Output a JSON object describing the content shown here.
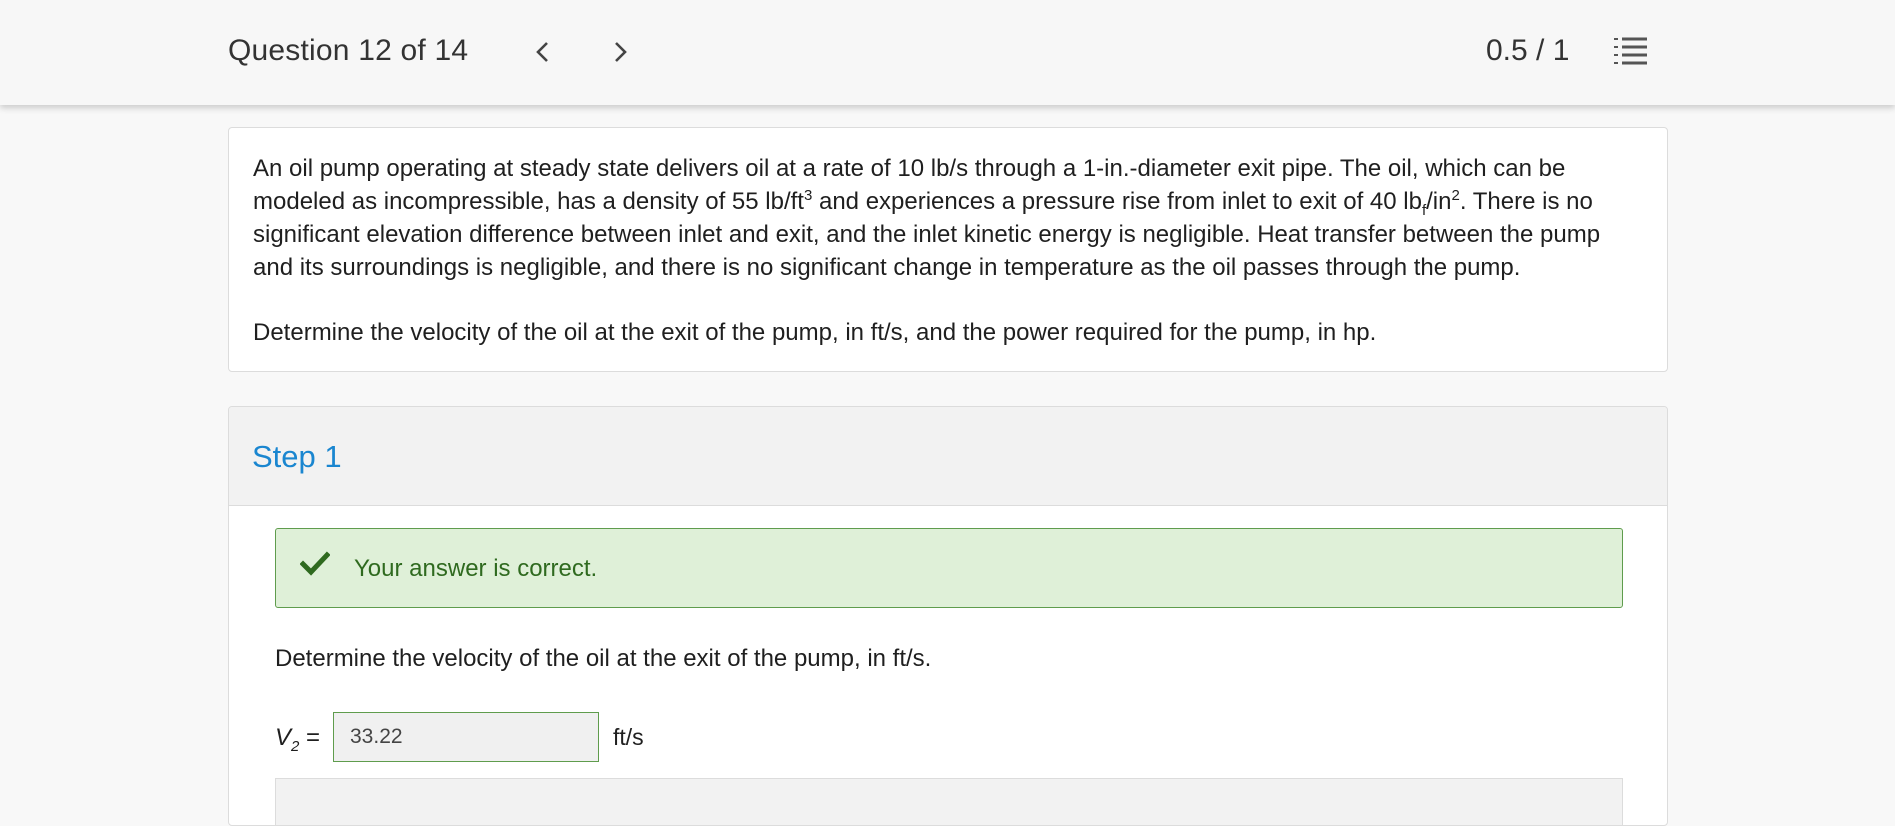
{
  "header": {
    "question_label": "Question 12 of 14",
    "score": "0.5 / 1",
    "icons": {
      "prev": "chevron-left-icon",
      "next": "chevron-right-icon",
      "list": "numbered-list-icon"
    }
  },
  "problem": {
    "p1_a": "An oil pump operating at steady state delivers oil at a rate of 10 lb/s through a 1-in.-diameter exit pipe. The oil, which can be modeled as incompressible, has a density of 55 lb/ft",
    "p1_sup1": "3",
    "p1_b": " and experiences a pressure rise from inlet to exit of 40 lb",
    "p1_sub1": "f",
    "p1_c": "/in",
    "p1_sup2": "2",
    "p1_d": ". There is no significant elevation difference between inlet and exit, and the inlet kinetic energy is negligible. Heat transfer between the pump and its surroundings is negligible, and there is no significant change in temperature as the oil passes through the pump.",
    "question": "Determine the velocity of the oil at the exit of the pump, in ft/s, and the power required for the pump, in hp."
  },
  "step": {
    "title": "Step 1",
    "feedback": "Your answer is correct.",
    "feedback_icon": "checkmark-icon",
    "question": "Determine the velocity of the oil at the exit of the pump, in ft/s.",
    "var_name": "V",
    "var_sub": "2",
    "var_eq": " =",
    "answer_value": "33.22",
    "unit": "ft/s"
  },
  "colors": {
    "accent": "#1a86d0",
    "correct_bg": "#dff0d8",
    "correct_border": "#5f9c4d",
    "correct_text": "#2f6a1f"
  }
}
